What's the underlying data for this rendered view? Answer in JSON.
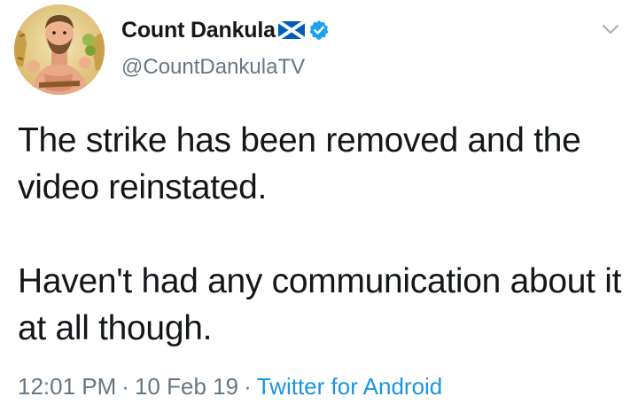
{
  "author": {
    "display_name": "Count Dankula",
    "handle": "@CountDankulaTV",
    "avatar_icon": "avatar-cartoon-portrait",
    "flag_icon": "scotland-flag-icon",
    "verified_icon": "verified-badge-icon"
  },
  "tweet": {
    "paragraphs": [
      "The strike has been removed and the video reinstated.",
      "Haven't had any communication about it at all though."
    ]
  },
  "meta": {
    "time": "12:01 PM",
    "separator": "·",
    "date": "10 Feb 19",
    "source": "Twitter for Android"
  },
  "colors": {
    "text": "#14171a",
    "secondary": "#657786",
    "link": "#1b95e0",
    "verified": "#1da1f2",
    "flag_blue": "#005eb8"
  }
}
